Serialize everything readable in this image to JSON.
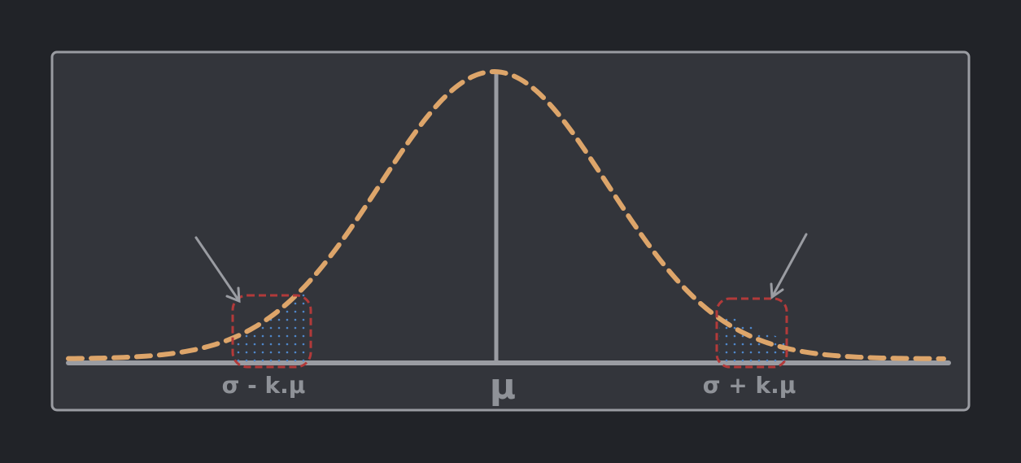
{
  "labels": {
    "left": "σ - k.μ",
    "center": "μ",
    "right": "σ + k.μ"
  },
  "colors": {
    "background": "#212328",
    "panel": "#33353b",
    "frame": "#9a9ca2",
    "curve": "#dda56a",
    "region_outline": "#b23a3a",
    "region_dots": "#4f86c8"
  }
}
